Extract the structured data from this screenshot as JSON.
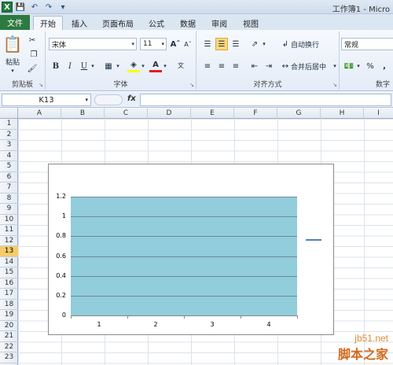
{
  "window": {
    "title": "工作簿1 - Micro"
  },
  "tabs": [
    {
      "label": "文件"
    },
    {
      "label": "开始"
    },
    {
      "label": "插入"
    },
    {
      "label": "页面布局"
    },
    {
      "label": "公式"
    },
    {
      "label": "数据"
    },
    {
      "label": "审阅"
    },
    {
      "label": "视图"
    }
  ],
  "ribbon": {
    "clipboard": {
      "label": "剪贴板",
      "paste_label": "粘贴"
    },
    "font": {
      "label": "字体",
      "font_name": "宋体",
      "font_size": "11"
    },
    "alignment": {
      "label": "对齐方式",
      "wrap_text": "自动换行",
      "merge_center": "合并后居中"
    },
    "number": {
      "label": "数字",
      "format": "常规"
    }
  },
  "formula_bar": {
    "name_box": "K13",
    "fx": "fx",
    "content": ""
  },
  "grid": {
    "columns": [
      "A",
      "B",
      "C",
      "D",
      "E",
      "F",
      "G",
      "H",
      "I"
    ],
    "rows": [
      "1",
      "2",
      "3",
      "4",
      "5",
      "6",
      "7",
      "8",
      "9",
      "10",
      "11",
      "12",
      "13",
      "14",
      "15",
      "16",
      "17",
      "18",
      "19",
      "20",
      "21",
      "22",
      "23"
    ],
    "active_row": "13"
  },
  "chart_data": {
    "type": "bar",
    "categories": [
      "1",
      "2",
      "3",
      "4"
    ],
    "values": [
      1.2,
      1.2,
      1.2,
      1.2
    ],
    "y_ticks": [
      "0",
      "0.2",
      "0.4",
      "0.6",
      "0.8",
      "1",
      "1.2"
    ],
    "ylim": [
      0,
      1.2
    ],
    "grid": true,
    "legend": "right",
    "fill_color": "#92cddc",
    "legend_color": "#4f81bd"
  },
  "watermark": {
    "site": "jb51.net",
    "text": "脚本之家"
  }
}
